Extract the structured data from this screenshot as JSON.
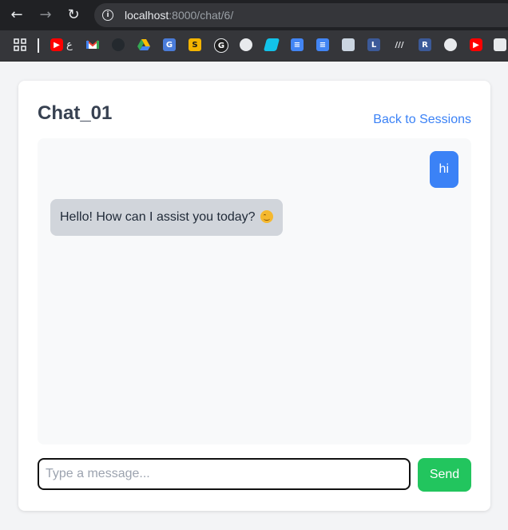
{
  "browser": {
    "url_host": "localhost",
    "url_path": ":8000/chat/6/",
    "bookmark_text": "ع",
    "bookmark_r_label": "R"
  },
  "page": {
    "title": "Chat_01",
    "back_link": "Back to Sessions",
    "messages": [
      {
        "role": "user",
        "text": "hi"
      },
      {
        "role": "assistant",
        "text": "Hello! How can I assist you today?"
      }
    ],
    "input_placeholder": "Type a message...",
    "send_label": "Send"
  },
  "colors": {
    "user_bubble": "#3b82f6",
    "assistant_bubble": "#d1d5db",
    "send_button": "#22c55e",
    "link": "#3b82f6"
  }
}
